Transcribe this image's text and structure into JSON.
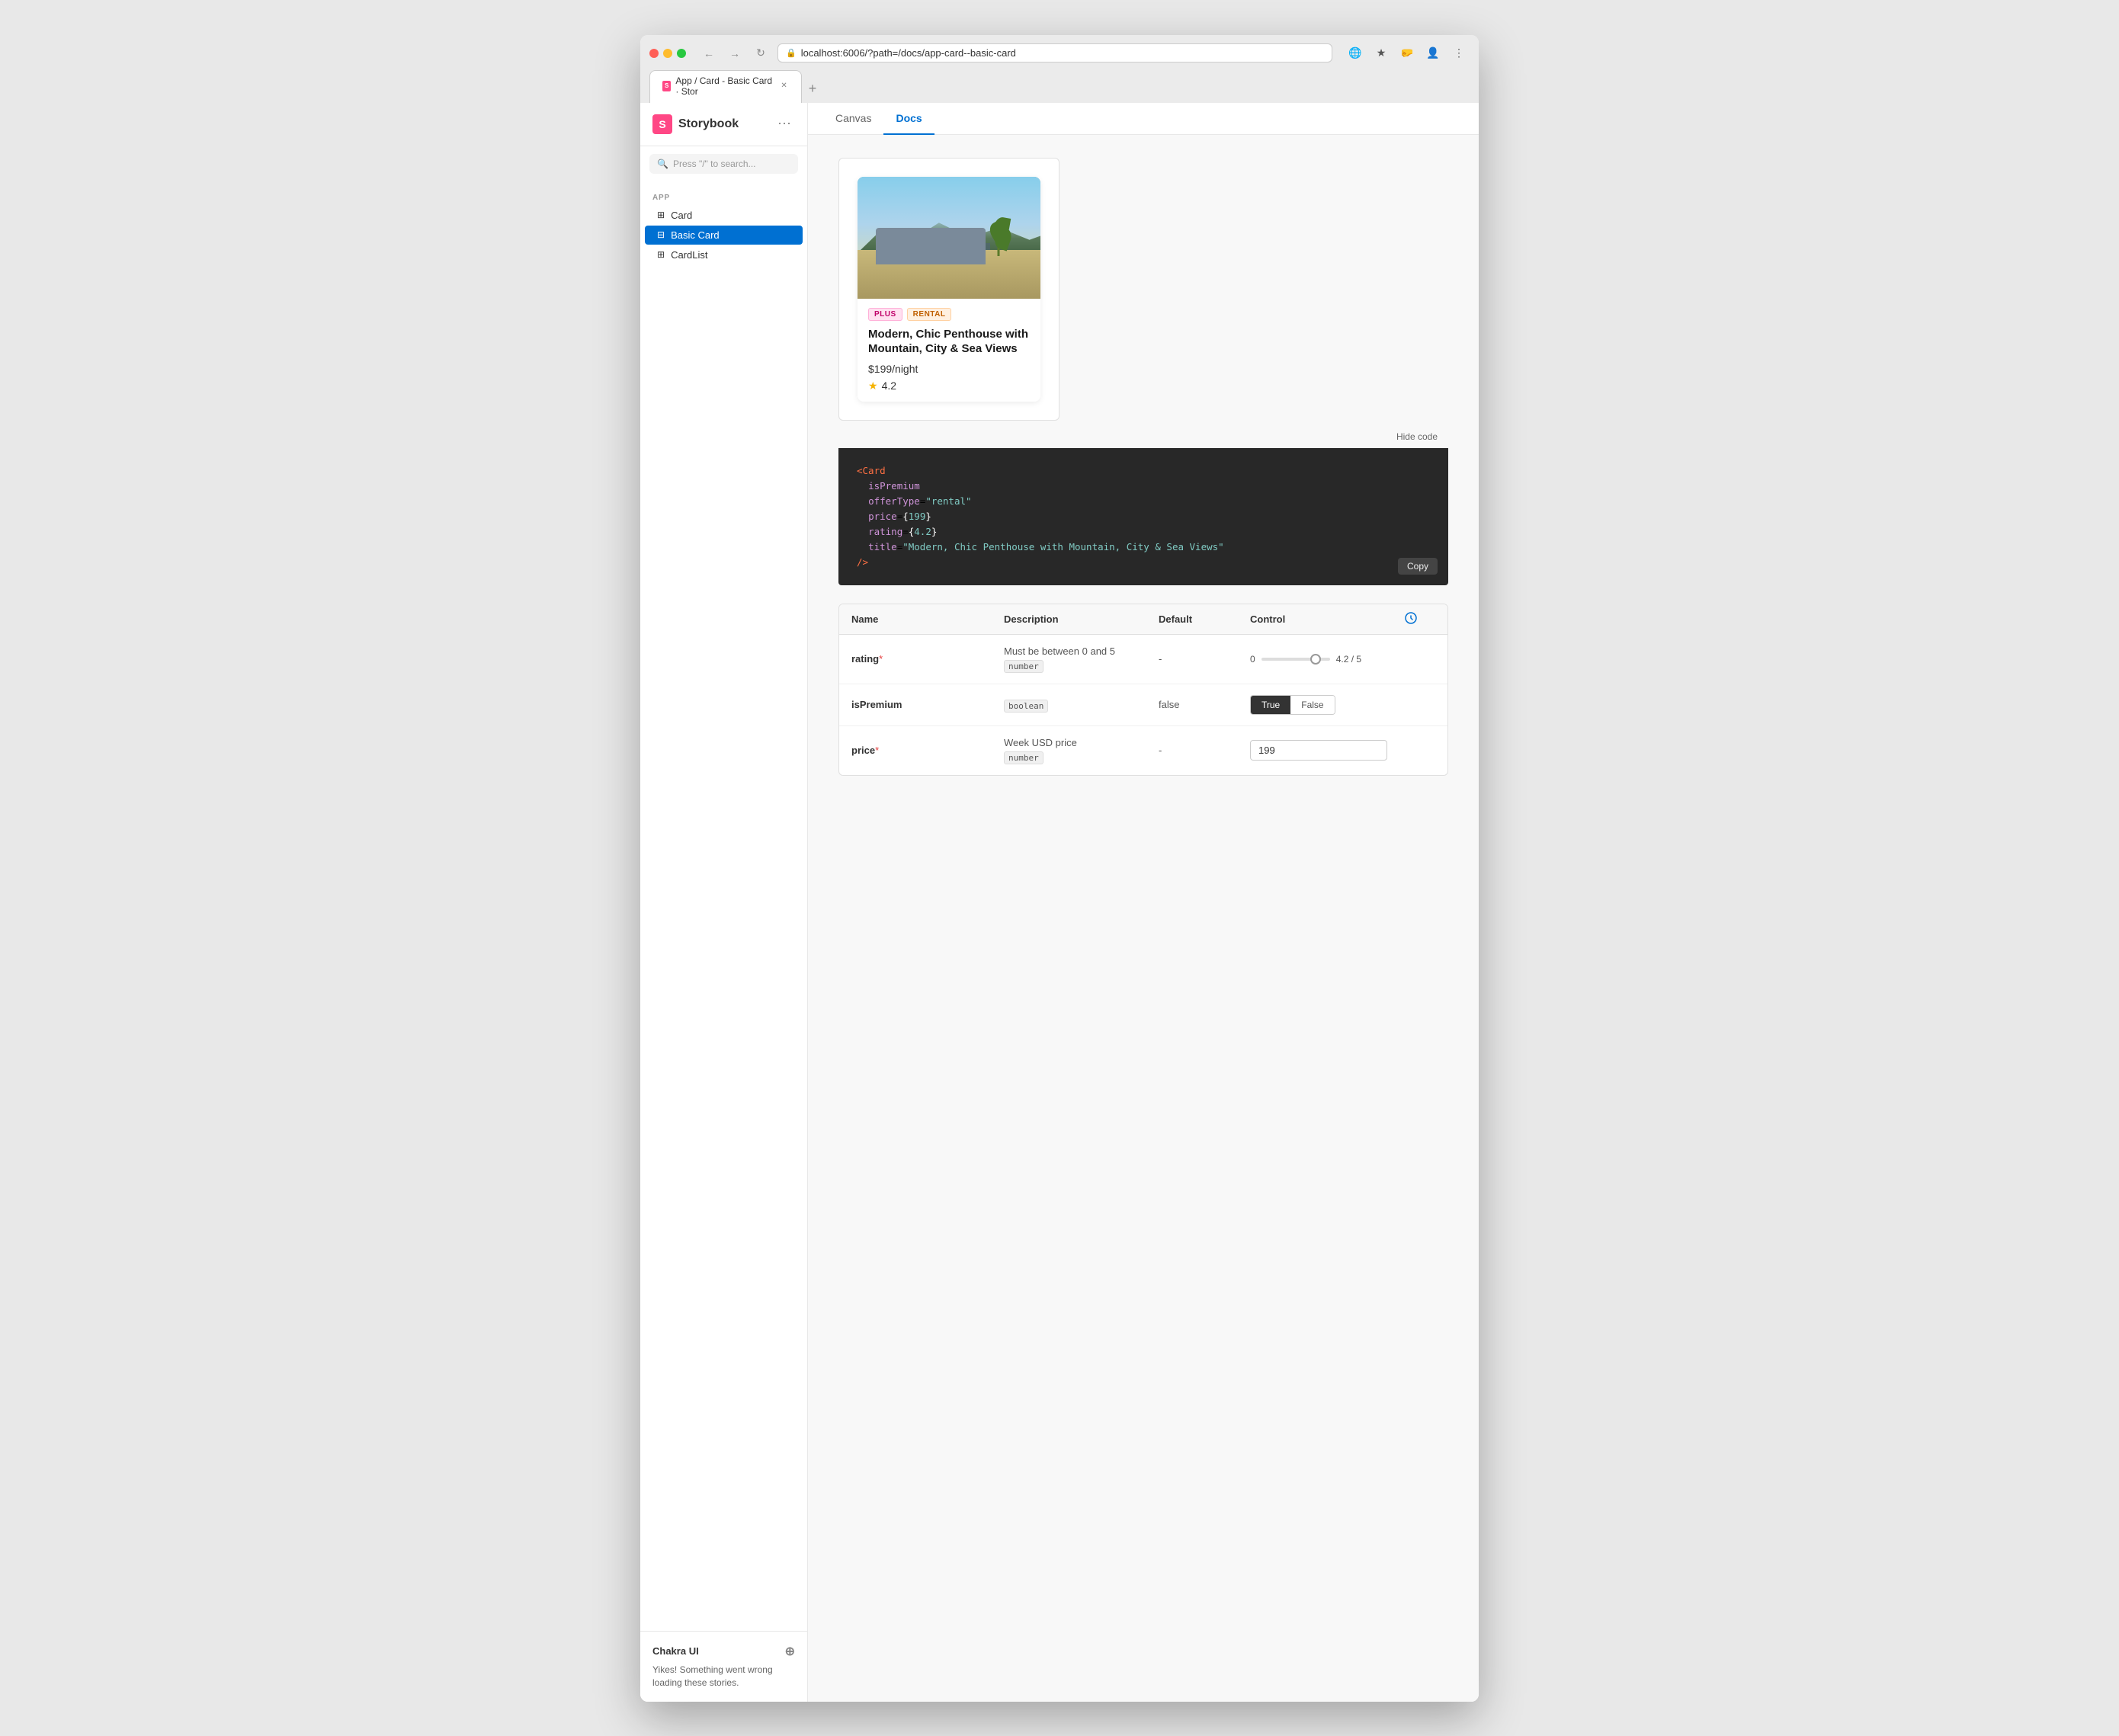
{
  "browser": {
    "tab_title": "App / Card - Basic Card · Stor",
    "url": "localhost:6006/?path=/docs/app-card--basic-card",
    "favicon_letter": "S"
  },
  "sidebar": {
    "logo": "Storybook",
    "search_placeholder": "Press \"/\" to search...",
    "section_label": "APP",
    "items": [
      {
        "label": "Card",
        "icon": "⊞",
        "active": false
      },
      {
        "label": "Basic Card",
        "icon": "⊟",
        "active": true
      },
      {
        "label": "CardList",
        "icon": "⊞",
        "active": false
      }
    ],
    "addon_title": "Chakra UI",
    "addon_error": "Yikes! Something went wrong loading these stories."
  },
  "main_tabs": [
    {
      "label": "Canvas",
      "active": false
    },
    {
      "label": "Docs",
      "active": true
    }
  ],
  "card": {
    "badges": [
      "PLUS",
      "RENTAL"
    ],
    "title": "Modern, Chic Penthouse with Mountain, City & Sea Views",
    "price": "$199/night",
    "rating": "4.2"
  },
  "code": {
    "lines": [
      {
        "content": "<Card",
        "classes": [
          "c-tag"
        ]
      },
      {
        "content": "  isPremium",
        "classes": [
          "c-attr"
        ]
      },
      {
        "content": "  offerType=\"rental\"",
        "attr": "offerType",
        "val": "\"rental\""
      },
      {
        "content": "  price={199}",
        "attr": "price",
        "val": "{199}"
      },
      {
        "content": "  rating={4.2}",
        "attr": "rating",
        "val": "{4.2}"
      },
      {
        "content": "  title=\"Modern, Chic Penthouse with Mountain, City & Sea Views\"",
        "attr": "title",
        "val": "\"Modern, Chic Penthouse with Mountain, City & Sea Views\""
      },
      {
        "content": "/>",
        "classes": [
          "c-tag"
        ]
      }
    ],
    "hide_code_label": "Hide code",
    "copy_label": "Copy"
  },
  "props_table": {
    "headers": [
      "Name",
      "Description",
      "Default",
      "Control",
      ""
    ],
    "rows": [
      {
        "name": "rating",
        "required": true,
        "description": "Must be between 0 and 5",
        "type": "number",
        "default": "-",
        "control_type": "range",
        "range_min": "0",
        "range_max": "5",
        "range_value": "4.2",
        "range_label": "4.2 / 5"
      },
      {
        "name": "isPremium",
        "required": false,
        "description": "",
        "type": "boolean",
        "default": "false",
        "control_type": "toggle",
        "toggle_options": [
          "True",
          "False"
        ],
        "toggle_active": "True"
      },
      {
        "name": "price",
        "required": true,
        "description": "Week USD price",
        "type": "number",
        "default": "-",
        "control_type": "text",
        "text_value": "199"
      }
    ]
  }
}
